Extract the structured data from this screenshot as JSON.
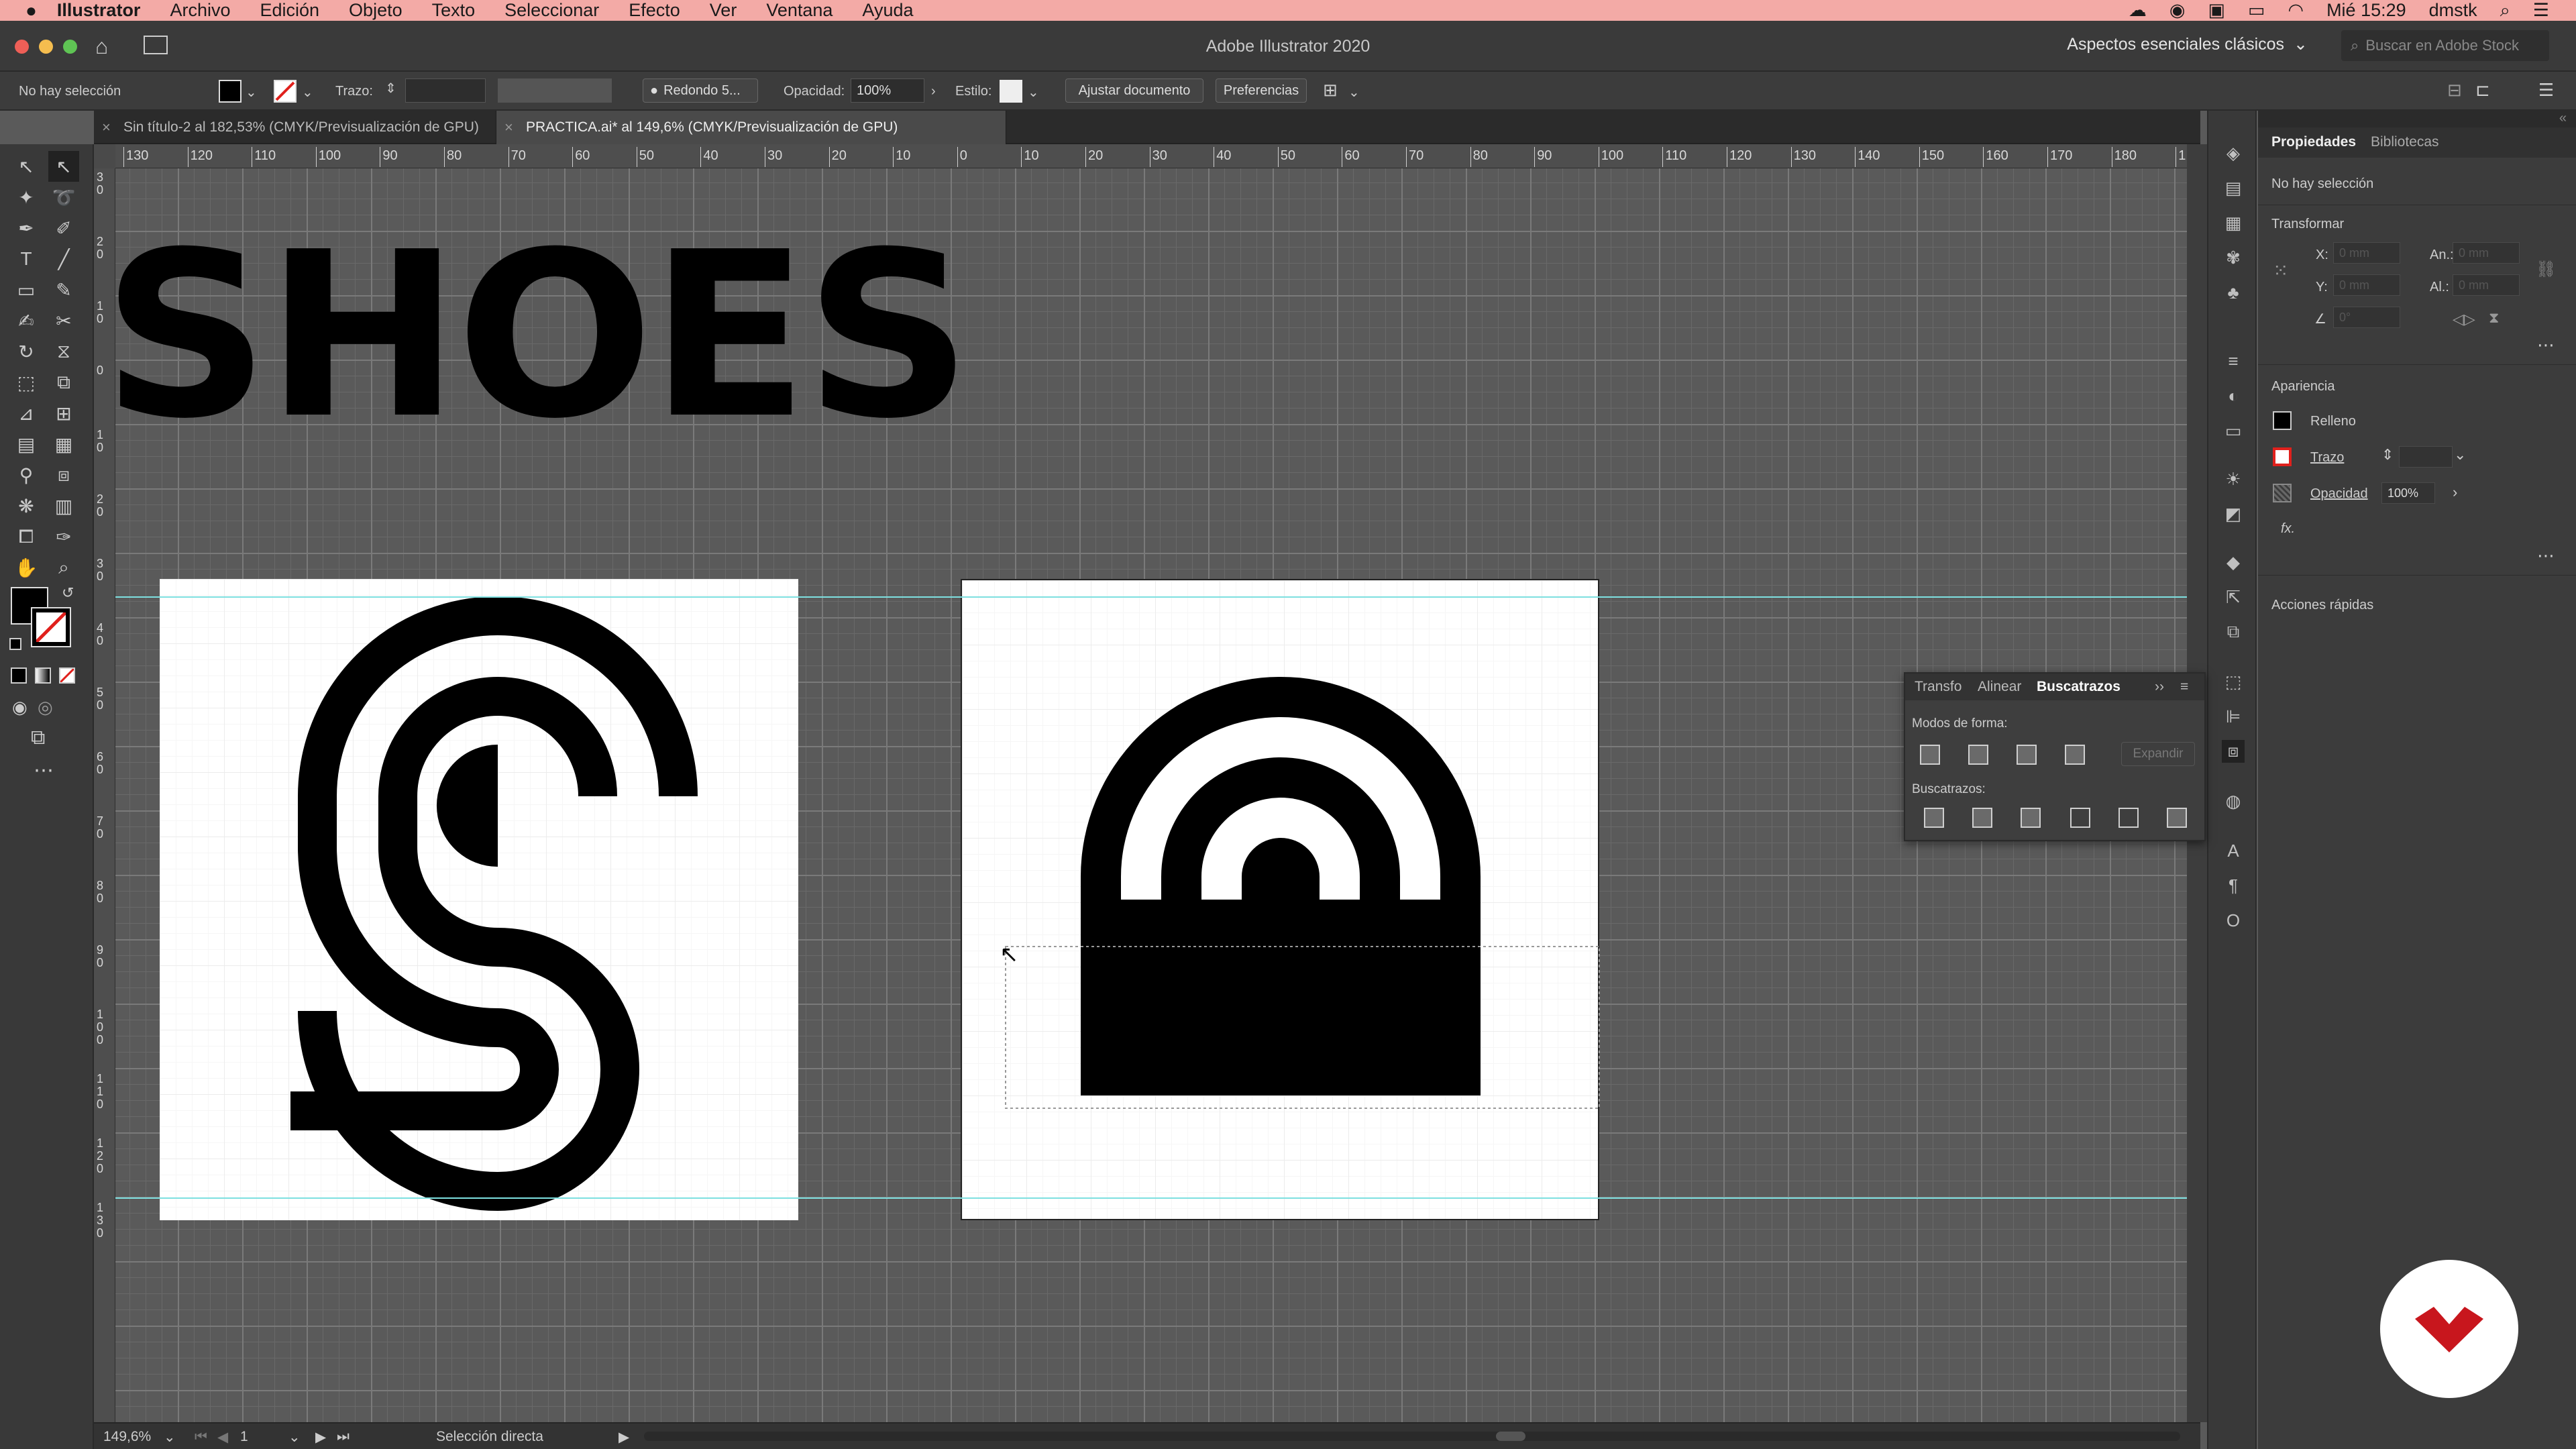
{
  "menubar": {
    "apple": "",
    "app": "Illustrator",
    "items": [
      "Archivo",
      "Edición",
      "Objeto",
      "Texto",
      "Seleccionar",
      "Efecto",
      "Ver",
      "Ventana",
      "Ayuda"
    ],
    "clock": "Mié 15:29",
    "user": "dmstk"
  },
  "window": {
    "title": "Adobe Illustrator 2020",
    "workspace": "Aspectos esenciales clásicos",
    "stock_placeholder": "Buscar en Adobe Stock"
  },
  "control": {
    "selection": "No hay selección",
    "stroke_label": "Trazo:",
    "brush": "Redondo 5...",
    "opacity_label": "Opacidad:",
    "opacity_value": "100%",
    "style_label": "Estilo:",
    "fit_button": "Ajustar documento",
    "prefs_button": "Preferencias"
  },
  "tabs": [
    {
      "label": "Sin título-2 al 182,53% (CMYK/Previsualización de GPU)"
    },
    {
      "label": "PRACTICA.ai* al 149,6% (CMYK/Previsualización de GPU)"
    }
  ],
  "ruler": {
    "h_ticks": [
      "130",
      "120",
      "110",
      "100",
      "90",
      "80",
      "70",
      "60",
      "50",
      "40",
      "30",
      "20",
      "10",
      "0",
      "10",
      "20",
      "30",
      "40",
      "50",
      "60",
      "70",
      "80",
      "90",
      "100",
      "110",
      "120",
      "130",
      "140",
      "150",
      "160",
      "170",
      "180",
      "1"
    ],
    "v_ticks": [
      "3 0",
      "2 0",
      "1 0",
      "0",
      "1 0",
      "2 0",
      "3 0",
      "4 0",
      "5 0",
      "6 0",
      "7 0",
      "8 0",
      "9 0",
      "1 0 0",
      "1 1 0",
      "1 2 0",
      "1 3 0"
    ]
  },
  "canvas": {
    "headline": "SHOES"
  },
  "status": {
    "zoom": "149,6%",
    "page": "1",
    "tool": "Selección directa"
  },
  "properties": {
    "tab_props": "Propiedades",
    "tab_libs": "Bibliotecas",
    "no_selection": "No hay selección",
    "transform_title": "Transformar",
    "x_label": "X:",
    "y_label": "Y:",
    "w_label": "An.:",
    "h_label": "Al.:",
    "x_value": "0 mm",
    "y_value": "0 mm",
    "w_value": "0 mm",
    "h_value": "0 mm",
    "angle_value": "0°",
    "appearance_title": "Apariencia",
    "fill_label": "Relleno",
    "stroke_label": "Trazo",
    "opacity_label": "Opacidad",
    "opacity_value": "100%",
    "fx_label": "fx.",
    "quick_actions": "Acciones rápidas"
  },
  "pathfinder": {
    "tab_transform": "Transfo",
    "tab_align": "Alinear",
    "tab_pathfinder": "Buscatrazos",
    "shape_modes": "Modos de forma:",
    "expand": "Expandir",
    "pathfinders": "Buscatrazos:"
  },
  "colors": {
    "menubar": "#f3aaa6",
    "ui_dark": "#3c3c3c",
    "canvas": "#5a5a5a",
    "guide": "#7ee0e0",
    "logo_red": "#c8161d"
  }
}
